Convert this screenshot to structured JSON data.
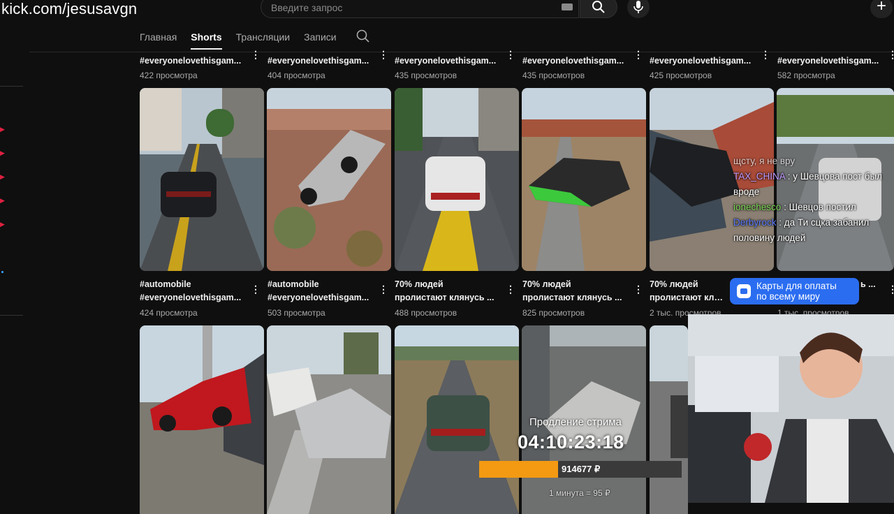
{
  "channel_url": "kick.com/jesusavgn",
  "search": {
    "placeholder": "Введите запрос"
  },
  "tabs": [
    {
      "label": "Главная",
      "active": false
    },
    {
      "label": "Shorts",
      "active": true
    },
    {
      "label": "Трансляции",
      "active": false
    },
    {
      "label": "Записи",
      "active": false
    }
  ],
  "row1": [
    {
      "title": "#everyonelovethisgam...",
      "views": "422 просмотра"
    },
    {
      "title": "#everyonelovethisgam...",
      "views": "404 просмотра"
    },
    {
      "title": "#everyonelovethisgam...",
      "views": "435 просмотров"
    },
    {
      "title": "#everyonelovethisgam...",
      "views": "435 просмотров"
    },
    {
      "title": "#everyonelovethisgam...",
      "views": "425 просмотров"
    },
    {
      "title": "#everyonelovethisgam...",
      "views": "582 просмотра"
    }
  ],
  "row2": [
    {
      "line1": "#automobile",
      "line2": "#everyonelovethisgam...",
      "views": "424 просмотра"
    },
    {
      "line1": "#automobile",
      "line2": "#everyonelovethisgam...",
      "views": "503 просмотра"
    },
    {
      "line1": "70% людей",
      "line2": "пролистают клянусь ...",
      "views": "488 просмотров"
    },
    {
      "line1": "70% людей",
      "line2": "пролистают клянусь ...",
      "views": "825 просмотров"
    },
    {
      "line1": "70% людей",
      "line2": "пролистают клянусь ...",
      "views": "2 тыс. просмотров"
    },
    {
      "line1": "",
      "line2": "ь ...",
      "views": "1 тыс. просмотров"
    }
  ],
  "chat": [
    {
      "user": "",
      "text": "щсту, я не вру"
    },
    {
      "user": "TAX_CHINA",
      "text": ": у Шевцова пост был вроде"
    },
    {
      "user": "ionechesco",
      "text": ": Шевцов постил"
    },
    {
      "user": "Derbyrock",
      "text": ": да Ти сцка забанил половину людей"
    }
  ],
  "promo": {
    "line1": "Карты для оплаты",
    "line2": "по всему миру"
  },
  "stream": {
    "label": "Продление стрима",
    "timer": "04:10:23:18",
    "amount": "914677 ₽",
    "progress": 0.39,
    "rate": "1 минута = 95 ₽"
  },
  "colors": {
    "accent_bar": "#f39a12",
    "promo": "#2b6df0"
  }
}
